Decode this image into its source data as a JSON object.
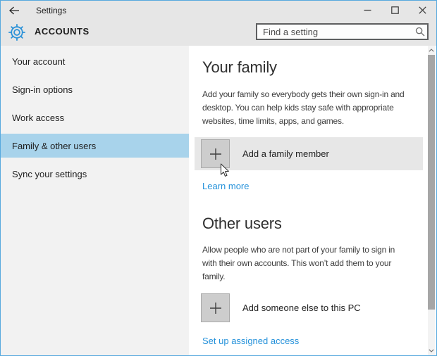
{
  "titlebar": {
    "title": "Settings"
  },
  "header": {
    "section_title": "ACCOUNTS",
    "search": {
      "placeholder": "Find a setting"
    }
  },
  "sidebar": {
    "items": [
      "Your account",
      "Sign-in options",
      "Work access",
      "Family & other users",
      "Sync your settings"
    ],
    "selected_index": 3
  },
  "your_family": {
    "heading": "Your family",
    "description_lines": [
      "Add your family so everybody gets their own sign-in and",
      "desktop. You can help kids stay safe with appropriate",
      "websites, time limits, apps, and games."
    ],
    "add_button_label": "Add a family member",
    "learn_more_label": "Learn more"
  },
  "other_users": {
    "heading": "Other users",
    "description_lines": [
      "Allow people who are not part of your family to sign in",
      "with their own accounts. This won’t add them to your",
      "family."
    ],
    "add_button_label": "Add someone else to this PC",
    "assigned_access_label": "Set up assigned access"
  },
  "icons": {
    "back": "arrow-left",
    "settings": "gear",
    "search": "magnifier",
    "minimize": "horizontal-line",
    "maximize": "square-outline",
    "close": "x-cross",
    "add_buttons": "plus",
    "scroll_up": "chevron-up",
    "scroll_down": "chevron-down",
    "pointer": "mouse-arrow"
  },
  "colors": {
    "window_border": "#57a9de",
    "titlebar_bg": "#e6e6e6",
    "sidebar_bg": "#f2f2f2",
    "sidebar_selected_bg": "#a8d3eb",
    "link_blue": "#2491da",
    "gear_blue": "#2e93d8",
    "hover_row_bg": "#e7e7e7",
    "plus_square_bg": "#cdcdcd"
  }
}
